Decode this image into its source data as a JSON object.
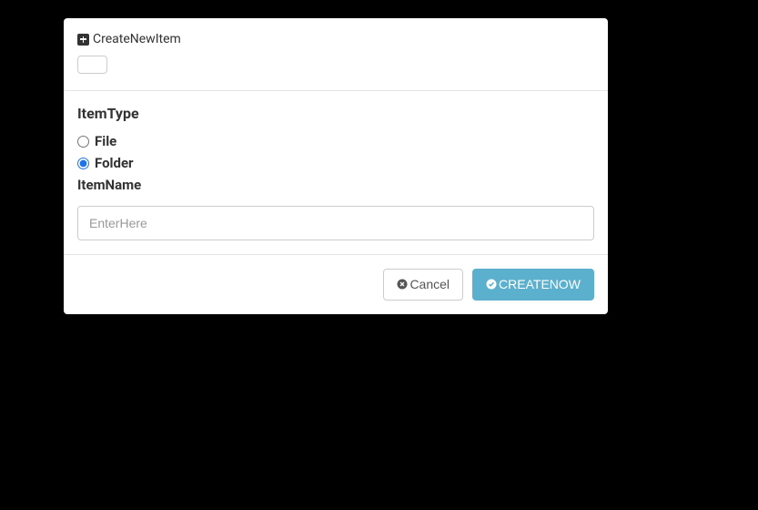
{
  "modal": {
    "title": "CreateNewItem",
    "body": {
      "typeLabel": "ItemType",
      "options": {
        "file": {
          "label": "File",
          "checked": false
        },
        "folder": {
          "label": "Folder",
          "checked": true
        }
      },
      "nameLabel": "ItemName",
      "input": {
        "placeholder": "EnterHere",
        "value": ""
      }
    },
    "footer": {
      "cancel": "Cancel",
      "create": "CREATENOW"
    }
  }
}
